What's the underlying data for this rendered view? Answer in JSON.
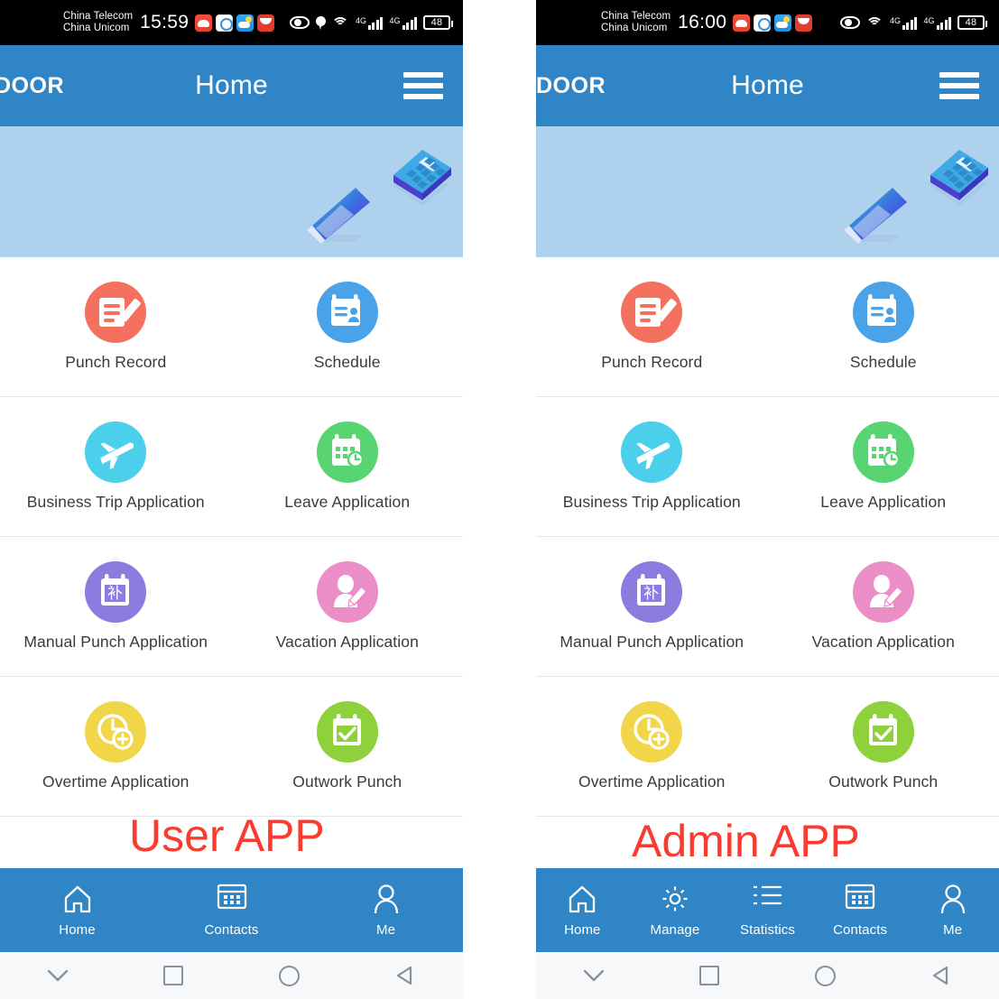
{
  "meta": {
    "accent_blue": "#2f85c6",
    "banner_blue": "#aed1ee",
    "overlay_red": "#fb3b30"
  },
  "phones": [
    {
      "id": "user-app",
      "overlay_label": "User APP",
      "statusbar": {
        "carrier_line1": "China Telecom",
        "carrier_line2": "China Unicom",
        "time": "15:59",
        "app_icons": [
          "cloud-app-icon",
          "search-app-icon",
          "weather-app-icon",
          "shopping-app-icon"
        ],
        "right_icons": [
          "eye-icon",
          "location-pin-icon",
          "wifi-icon",
          "signal-4g-icon",
          "signal-4g-icon",
          "battery-icon"
        ],
        "network_label": "4G",
        "battery_level": "48"
      },
      "appbar": {
        "brand": "DOOR",
        "title": "Home",
        "menu_icon": "hamburger-menu-icon"
      },
      "banner": {
        "illustrations": [
          "laptop-illustration",
          "calculator-illustration"
        ]
      },
      "grid": [
        {
          "label": "Punch Record",
          "icon": "document-pencil-icon",
          "color": "#f4715f"
        },
        {
          "label": "Schedule",
          "icon": "calendar-person-icon",
          "color": "#4aa3e8"
        },
        {
          "label": "Business Trip Application",
          "icon": "airplane-icon",
          "color": "#4ccfeb"
        },
        {
          "label": "Leave Application",
          "icon": "calendar-clock-icon",
          "color": "#58d572"
        },
        {
          "label": "Manual Punch Application",
          "icon": "calendar-bu-icon",
          "color": "#8b7ce0",
          "glyph": "补"
        },
        {
          "label": "Vacation Application",
          "icon": "person-pencil-icon",
          "color": "#eb8ec7"
        },
        {
          "label": "Overtime Application",
          "icon": "clock-plus-icon",
          "color": "#f2d64a"
        },
        {
          "label": "Outwork Punch",
          "icon": "calendar-check-icon",
          "color": "#8ed13c"
        }
      ],
      "tabs": [
        {
          "label": "Home",
          "icon": "home-icon"
        },
        {
          "label": "Contacts",
          "icon": "contacts-grid-icon"
        },
        {
          "label": "Me",
          "icon": "person-icon"
        }
      ],
      "sysnav": [
        "chevron-down-icon",
        "recents-square-icon",
        "home-circle-icon",
        "back-triangle-icon"
      ]
    },
    {
      "id": "admin-app",
      "overlay_label": "Admin APP",
      "statusbar": {
        "carrier_line1": "China Telecom",
        "carrier_line2": "China Unicom",
        "time": "16:00",
        "app_icons": [
          "cloud-app-icon",
          "search-app-icon",
          "weather-app-icon",
          "shopping-app-icon"
        ],
        "right_icons": [
          "eye-icon",
          "wifi-icon",
          "signal-4g-icon",
          "signal-4g-icon",
          "battery-icon"
        ],
        "network_label": "4G",
        "battery_level": "48"
      },
      "appbar": {
        "brand": "DOOR",
        "title": "Home",
        "menu_icon": "hamburger-menu-icon"
      },
      "banner": {
        "illustrations": [
          "laptop-illustration",
          "calculator-illustration"
        ]
      },
      "grid": [
        {
          "label": "Punch Record",
          "icon": "document-pencil-icon",
          "color": "#f4715f"
        },
        {
          "label": "Schedule",
          "icon": "calendar-person-icon",
          "color": "#4aa3e8"
        },
        {
          "label": "Business Trip Application",
          "icon": "airplane-icon",
          "color": "#4ccfeb"
        },
        {
          "label": "Leave Application",
          "icon": "calendar-clock-icon",
          "color": "#58d572"
        },
        {
          "label": "Manual Punch Application",
          "icon": "calendar-bu-icon",
          "color": "#8b7ce0",
          "glyph": "补"
        },
        {
          "label": "Vacation Application",
          "icon": "person-pencil-icon",
          "color": "#eb8ec7"
        },
        {
          "label": "Overtime Application",
          "icon": "clock-plus-icon",
          "color": "#f2d64a"
        },
        {
          "label": "Outwork Punch",
          "icon": "calendar-check-icon",
          "color": "#8ed13c"
        }
      ],
      "tabs": [
        {
          "label": "Home",
          "icon": "home-icon"
        },
        {
          "label": "Manage",
          "icon": "gear-icon"
        },
        {
          "label": "Statistics",
          "icon": "list-icon"
        },
        {
          "label": "Contacts",
          "icon": "contacts-grid-icon"
        },
        {
          "label": "Me",
          "icon": "person-icon"
        }
      ],
      "sysnav": [
        "chevron-down-icon",
        "recents-square-icon",
        "home-circle-icon",
        "back-triangle-icon"
      ]
    }
  ]
}
